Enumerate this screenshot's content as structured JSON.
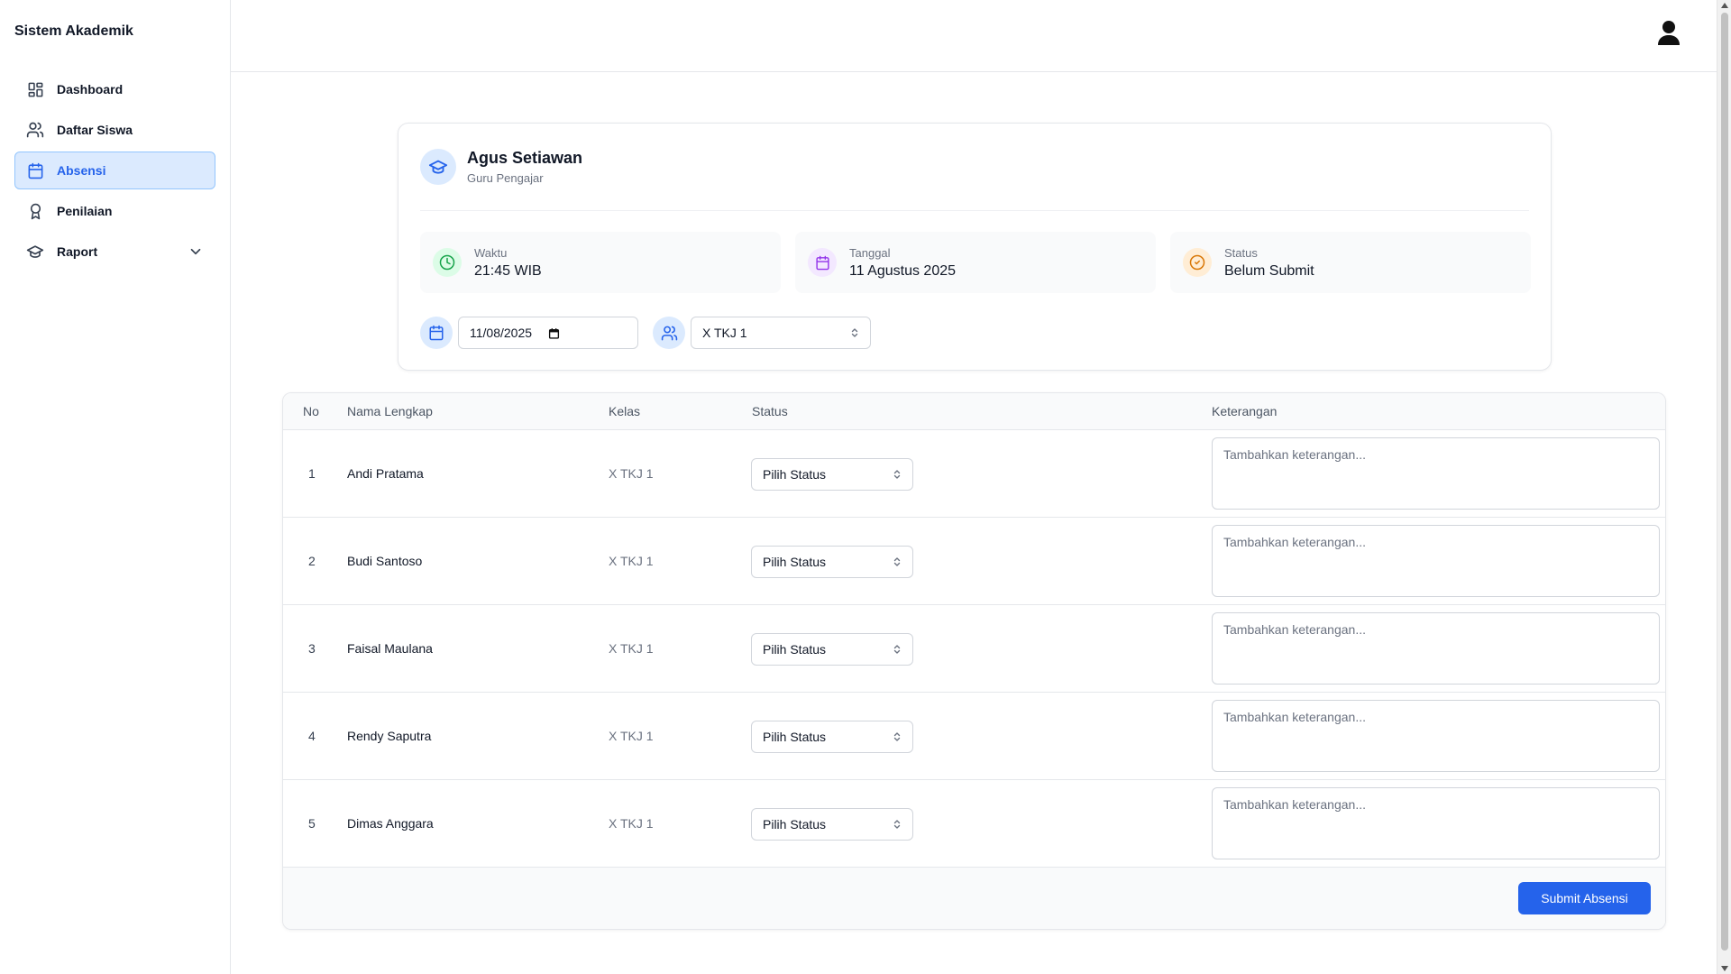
{
  "app": {
    "title": "Sistem Akademik"
  },
  "sidebar": {
    "items": [
      {
        "label": "Dashboard",
        "icon": "dashboard-icon",
        "active": false
      },
      {
        "label": "Daftar Siswa",
        "icon": "users-icon",
        "active": false
      },
      {
        "label": "Absensi",
        "icon": "calendar-icon",
        "active": true
      },
      {
        "label": "Penilaian",
        "icon": "award-icon",
        "active": false
      },
      {
        "label": "Raport",
        "icon": "graduation-cap-icon",
        "active": false,
        "expandable": true
      }
    ]
  },
  "teacher": {
    "name": "Agus Setiawan",
    "role": "Guru Pengajar"
  },
  "info": {
    "time": {
      "label": "Waktu",
      "value": "21:45 WIB"
    },
    "date": {
      "label": "Tanggal",
      "value": "11 Agustus 2025"
    },
    "status": {
      "label": "Status",
      "value": "Belum Submit"
    }
  },
  "filters": {
    "date": "11/08/2025",
    "class": "X TKJ 1"
  },
  "table": {
    "headers": {
      "no": "No",
      "name": "Nama Lengkap",
      "kelas": "Kelas",
      "status": "Status",
      "keterangan": "Keterangan"
    },
    "rows": [
      {
        "no": "1",
        "name": "Andi Pratama",
        "kelas": "X TKJ 1",
        "status": "Pilih Status"
      },
      {
        "no": "2",
        "name": "Budi Santoso",
        "kelas": "X TKJ 1",
        "status": "Pilih Status"
      },
      {
        "no": "3",
        "name": "Faisal Maulana",
        "kelas": "X TKJ 1",
        "status": "Pilih Status"
      },
      {
        "no": "4",
        "name": "Rendy Saputra",
        "kelas": "X TKJ 1",
        "status": "Pilih Status"
      },
      {
        "no": "5",
        "name": "Dimas Anggara",
        "kelas": "X TKJ 1",
        "status": "Pilih Status"
      }
    ],
    "ket_placeholder": "Tambahkan keterangan...",
    "submit_label": "Submit Absensi"
  },
  "colors": {
    "accent": "#2563eb",
    "active_bg": "#dbeafe",
    "time_icon": "#16a34a",
    "date_icon": "#9333ea",
    "status_icon": "#d97706"
  }
}
